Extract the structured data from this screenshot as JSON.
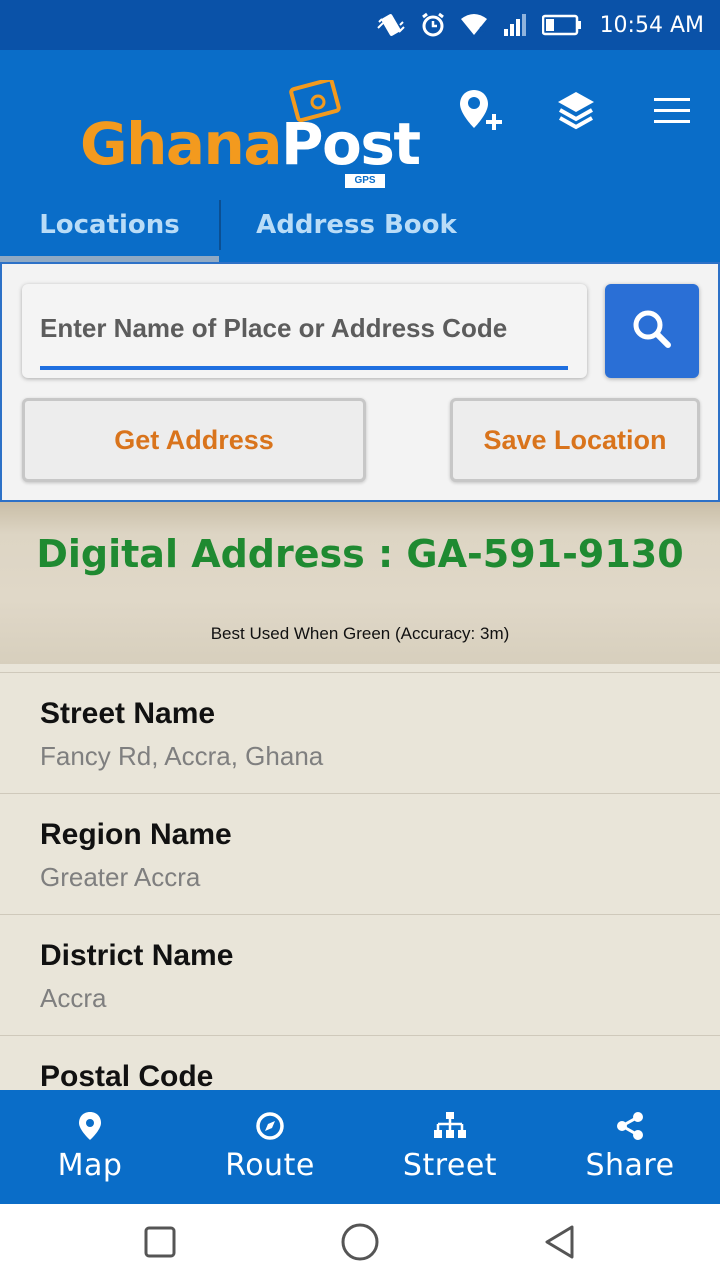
{
  "status_bar": {
    "time": "10:54 AM"
  },
  "header": {
    "logo_ghana": "Ghana",
    "logo_post": "Post",
    "logo_badge": "GPS",
    "icons": [
      "add-location-icon",
      "layers-icon",
      "menu-icon"
    ]
  },
  "tabs": [
    {
      "label": "Locations",
      "active": true
    },
    {
      "label": "Address Book",
      "active": false
    }
  ],
  "search": {
    "placeholder": "Enter Name of Place or Address Code",
    "value": ""
  },
  "actions": {
    "get_address": "Get Address",
    "save_location": "Save Location"
  },
  "digital": {
    "address": "Digital Address : GA-591-9130",
    "accuracy": "Best Used When Green (Accuracy: 3m)"
  },
  "details": [
    {
      "label": "Street Name",
      "value": "Fancy Rd, Accra, Ghana"
    },
    {
      "label": "Region Name",
      "value": "Greater Accra"
    },
    {
      "label": "District Name",
      "value": "Accra"
    },
    {
      "label": "Postal Code",
      "value": ""
    }
  ],
  "bottom_nav": [
    {
      "label": "Map",
      "icon": "map-pin-icon"
    },
    {
      "label": "Route",
      "icon": "compass-icon"
    },
    {
      "label": "Street",
      "icon": "sitemap-icon"
    },
    {
      "label": "Share",
      "icon": "share-icon"
    }
  ],
  "colors": {
    "header_blue": "#0a6dc8",
    "status_blue": "#0a52a8",
    "accent_orange": "#d9741c",
    "address_green": "#1f8a31",
    "search_blue": "#2a6fd6"
  }
}
